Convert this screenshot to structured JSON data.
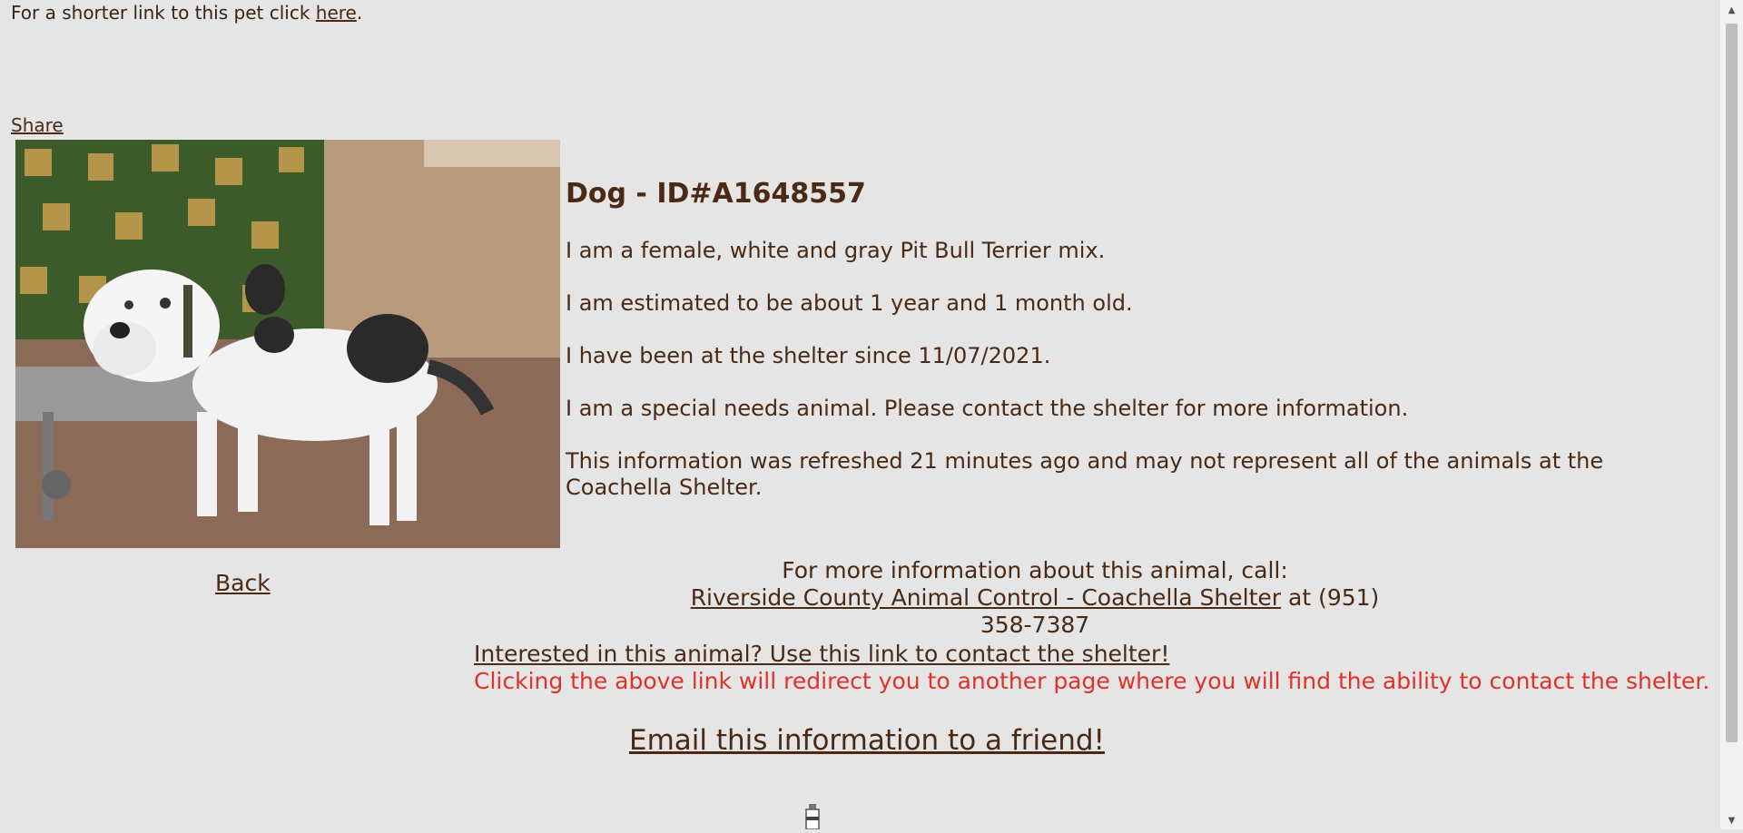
{
  "header": {
    "shorter_link_prefix": "For a shorter link to this pet click ",
    "shorter_link_label": "here",
    "shorter_link_suffix": ".",
    "share_label": "Share"
  },
  "pet": {
    "title": "Dog - ID#A1648557",
    "description": "I am a female, white and gray Pit Bull Terrier mix.",
    "age": "I am estimated to be about 1 year and 1 month old.",
    "since": "I have been at the shelter since 11/07/2021.",
    "special_needs": "I am a special needs animal. Please contact the shelter for more information.",
    "refresh_note": "This information was refreshed 21 minutes ago and may not represent all of the animals at the Coachella Shelter."
  },
  "nav": {
    "back_label": "Back"
  },
  "contact": {
    "call_prompt": "For more information about this animal, call:",
    "shelter_link": "Riverside County Animal Control - Coachella Shelter",
    "phone_text": " at (951) 358-7387",
    "interest_link": "Interested in this animal? Use this link to contact the shelter!",
    "redirect_notice": "Clicking the above link will redirect you to another page where you will find the ability to contact the shelter.",
    "email_link": "Email this information to a friend!"
  },
  "icons": {
    "photo": "dog-photo",
    "spinner": "loading-icon"
  },
  "colors": {
    "text": "#4a2a14",
    "warning": "#e0312b",
    "background": "#e5e5e5"
  }
}
